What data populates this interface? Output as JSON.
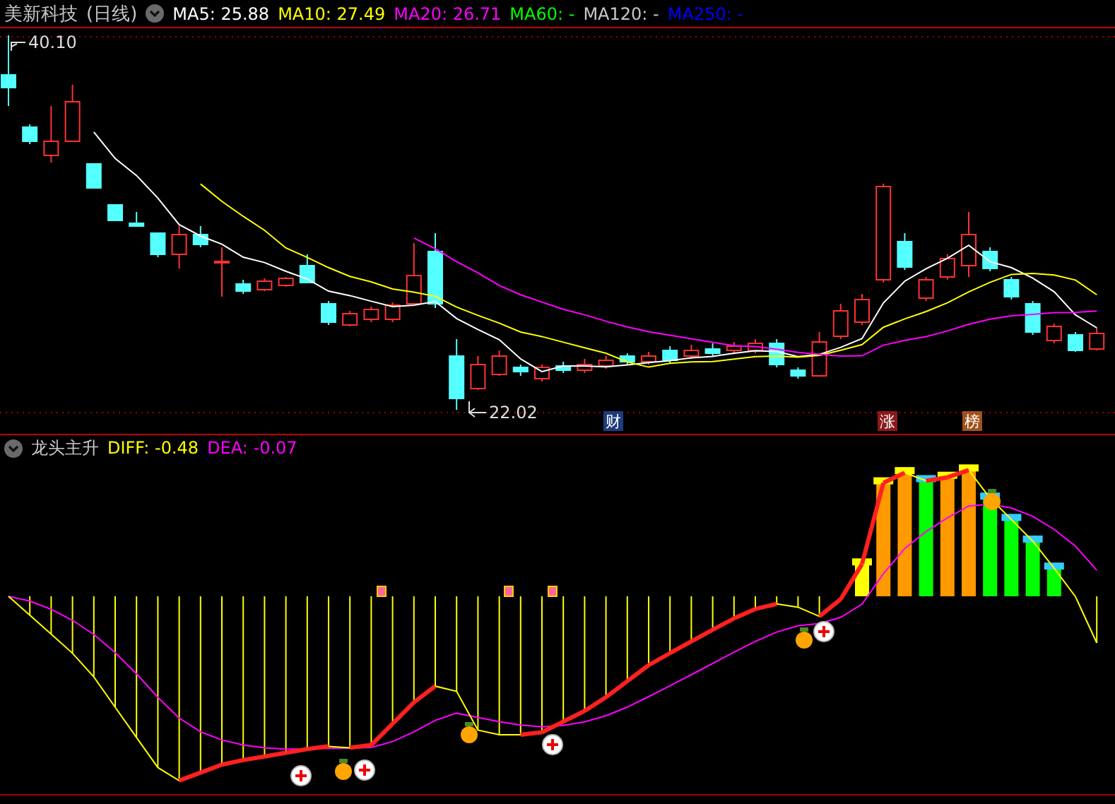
{
  "stock": {
    "name": "美新科技",
    "period": "(日线)"
  },
  "ma_legend": [
    {
      "label": "MA5: 25.88",
      "color": "#ffffff"
    },
    {
      "label": "MA10: 27.49",
      "color": "#ffff00"
    },
    {
      "label": "MA20: 26.71",
      "color": "#ff00ff"
    },
    {
      "label": "MA60: -",
      "color": "#00ff00"
    },
    {
      "label": "MA120: -",
      "color": "#c8c8c8"
    },
    {
      "label": "MA250: -",
      "color": "#0000ff"
    }
  ],
  "price_chart": {
    "high_label": "40.10",
    "low_label": "22.02",
    "event_badges": [
      {
        "text": "财",
        "color": "#1c3c7c"
      },
      {
        "text": "涨",
        "color": "#8b1a1a"
      },
      {
        "text": "榜",
        "color": "#a0521c"
      }
    ]
  },
  "indicator": {
    "name": "龙头主升",
    "legend": [
      {
        "label": "DIFF: -0.48",
        "color": "#ffff00"
      },
      {
        "label": "DEA: -0.07",
        "color": "#ff00ff"
      }
    ]
  }
}
